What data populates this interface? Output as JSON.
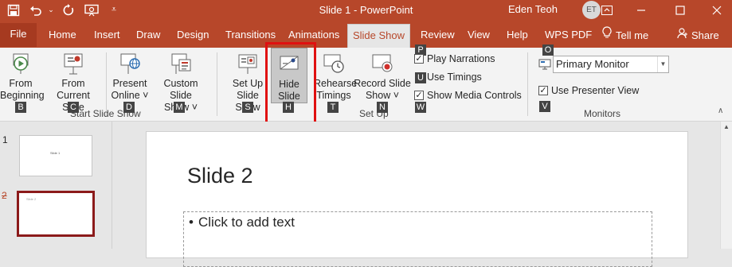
{
  "window": {
    "title": "Slide 1  -  PowerPoint",
    "user": "Eden Teoh",
    "avatar_initials": "ET",
    "accent": "#b7472a"
  },
  "quick_access": {
    "save": "save-icon",
    "undo": "undo-icon",
    "redo": "redo-icon",
    "present": "present-icon",
    "customize": "customize-icon"
  },
  "tabs": [
    "File",
    "Home",
    "Insert",
    "Draw",
    "Design",
    "Transitions",
    "Animations",
    "Slide Show",
    "Review",
    "View",
    "Help",
    "WPS PDF",
    "Tell me",
    "Share"
  ],
  "active_tab": "Slide Show",
  "ribbon": {
    "start": {
      "from_beginning": [
        "From",
        "Beginning"
      ],
      "from_current": [
        "From",
        "Current Slide"
      ],
      "present_online": [
        "Present",
        "Online ˅"
      ],
      "custom_show": [
        "Custom Slide",
        "Show ˅"
      ],
      "group": "Start Slide Show",
      "keytips": {
        "from_beginning": "B",
        "from_current": "C",
        "present_online": "D",
        "custom_show": "M"
      }
    },
    "setup": {
      "setup_show": [
        "Set Up",
        "Slide Show"
      ],
      "hide_slide": [
        "Hide",
        "Slide"
      ],
      "rehearse": [
        "Rehearse",
        "Timings"
      ],
      "record": [
        "Record Slide",
        "Show ˅"
      ],
      "group": "Set Up",
      "keytips": {
        "setup_show": "S",
        "hide_slide": "H",
        "rehearse": "T",
        "record": "N"
      },
      "checks": [
        {
          "label": "Play Narrations",
          "checked": true,
          "keytip": "P"
        },
        {
          "label": "Use Timings",
          "checked": true,
          "keytip": "U"
        },
        {
          "label": "Show Media Controls",
          "checked": true,
          "keytip": "W"
        }
      ]
    },
    "monitors": {
      "monitor_label": "Primary Monitor",
      "presenter_view": "Use Presenter View",
      "presenter_checked": true,
      "group": "Monitors",
      "keytips": {
        "monitor": "O",
        "presenter": "V"
      }
    }
  },
  "thumbnails": [
    {
      "number": "1",
      "text": "Slide 1"
    },
    {
      "number": "2",
      "text": "Slide 2",
      "hidden": true
    }
  ],
  "slide": {
    "title": "Slide 2",
    "body_placeholder": "Click to add text"
  }
}
